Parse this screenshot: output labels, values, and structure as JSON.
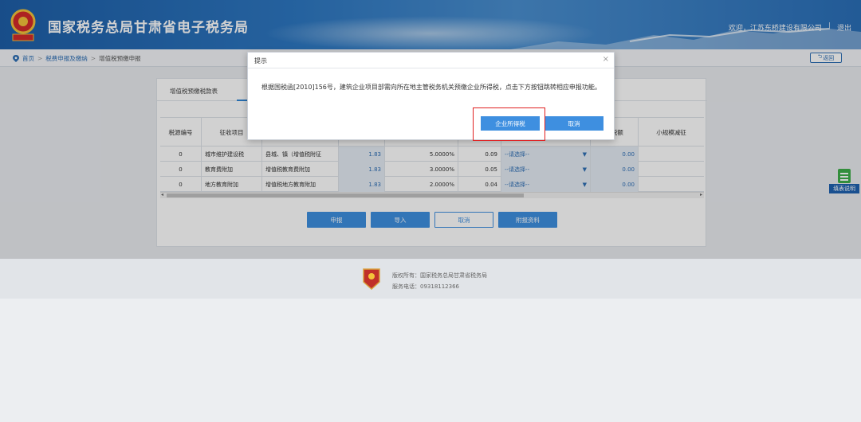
{
  "header": {
    "title": "国家税务总局甘肃省电子税务局",
    "welcome": "欢迎，江苏东桥建设有限公司",
    "separator": "|",
    "logout": "退出",
    "colors": {
      "brand": "#2e78c2"
    }
  },
  "breadcrumb": {
    "items": [
      "首页",
      "税费申报及缴纳",
      "增值税预缴申报"
    ],
    "back_label": "返回"
  },
  "tab": {
    "label": "增值税预缴税款表"
  },
  "table": {
    "headers": [
      "税源编号",
      "征收项目",
      "",
      "",
      "",
      "",
      "",
      "免税额",
      "小规模减征"
    ],
    "rows": [
      {
        "source_no": "0",
        "item": "城市维护建设税",
        "subitem": "县城、镇（增值税附征",
        "base": "1.83",
        "rate": "5.0000%",
        "amount": "0.09",
        "select": "--请选择--",
        "exempt": "0.00"
      },
      {
        "source_no": "0",
        "item": "教育费附加",
        "subitem": "增值税教育费附加",
        "base": "1.83",
        "rate": "3.0000%",
        "amount": "0.05",
        "select": "--请选择--",
        "exempt": "0.00"
      },
      {
        "source_no": "0",
        "item": "地方教育附加",
        "subitem": "增值税地方教育附加",
        "base": "1.83",
        "rate": "2.0000%",
        "amount": "0.04",
        "select": "--请选择--",
        "exempt": "0.00"
      }
    ]
  },
  "actions": {
    "declare": "申报",
    "import": "导入",
    "cancel": "取消",
    "attach": "附报资料"
  },
  "side_help": {
    "label": "填表说明"
  },
  "footer": {
    "copyright": "版权所有：国家税务总局甘肃省税务局",
    "phone": "服务电话：09318112366"
  },
  "dialog": {
    "title": "提示",
    "close": "×",
    "message": "根据国税函[2010]156号，建筑企业项目部需向所在地主管税务机关预缴企业所得税，点击下方按钮跳转相应申报功能。",
    "confirm_label": "企业所得税",
    "cancel_label": "取消"
  }
}
